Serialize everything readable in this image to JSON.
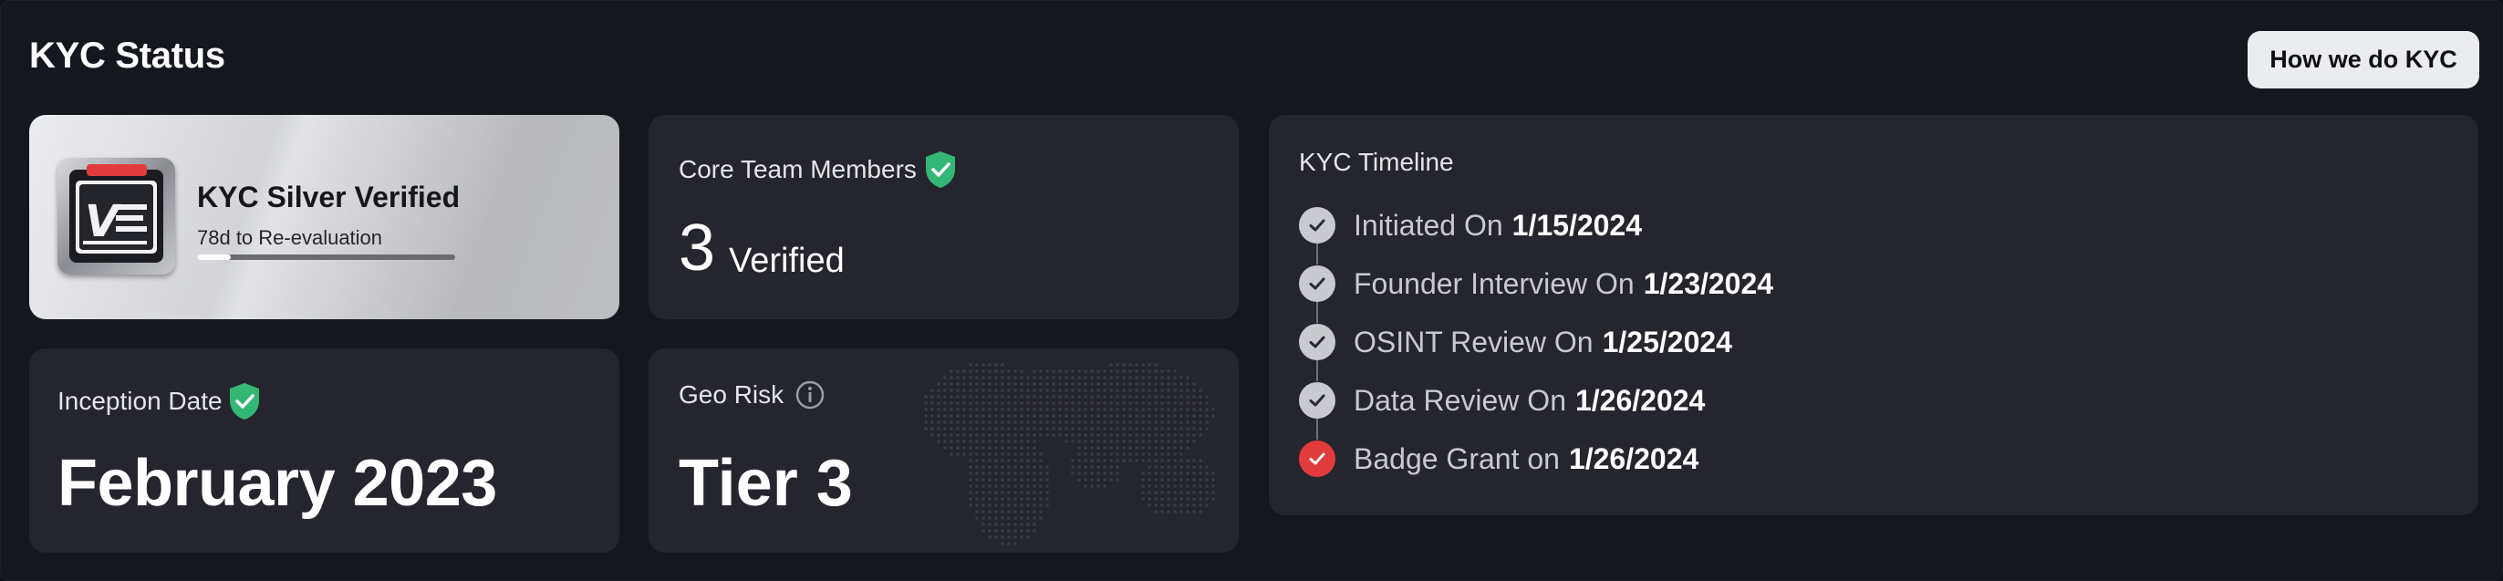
{
  "header": {
    "title": "KYC Status",
    "how_button": "How we do KYC"
  },
  "badge": {
    "name": "KYC Silver Verified",
    "reevaluation": "78d to Re-evaluation",
    "progress": 0.13,
    "icon_letters": "V"
  },
  "team": {
    "label": "Core Team Members",
    "count": "3",
    "status": "Verified"
  },
  "inception": {
    "label": "Inception Date",
    "value": "February 2023"
  },
  "geo": {
    "label": "Geo Risk",
    "value": "Tier 3"
  },
  "timeline": {
    "title": "KYC Timeline",
    "items": [
      {
        "label": "Initiated On",
        "date": "1/15/2024",
        "state": "done"
      },
      {
        "label": "Founder Interview On",
        "date": "1/23/2024",
        "state": "done"
      },
      {
        "label": "OSINT Review On",
        "date": "1/25/2024",
        "state": "done"
      },
      {
        "label": "Data Review On",
        "date": "1/26/2024",
        "state": "done"
      },
      {
        "label": "Badge Grant on",
        "date": "1/26/2024",
        "state": "granted"
      }
    ]
  },
  "colors": {
    "verified_green": "#34b675",
    "badge_red": "#e23b3b",
    "card_bg": "#25262d",
    "panel_bg": "#14171d"
  },
  "icons": {
    "verified": "shield-check-icon",
    "info": "info-circle-icon",
    "step_done": "check-circle-icon",
    "step_granted": "check-circle-red-icon",
    "map": "world-map-dots"
  }
}
